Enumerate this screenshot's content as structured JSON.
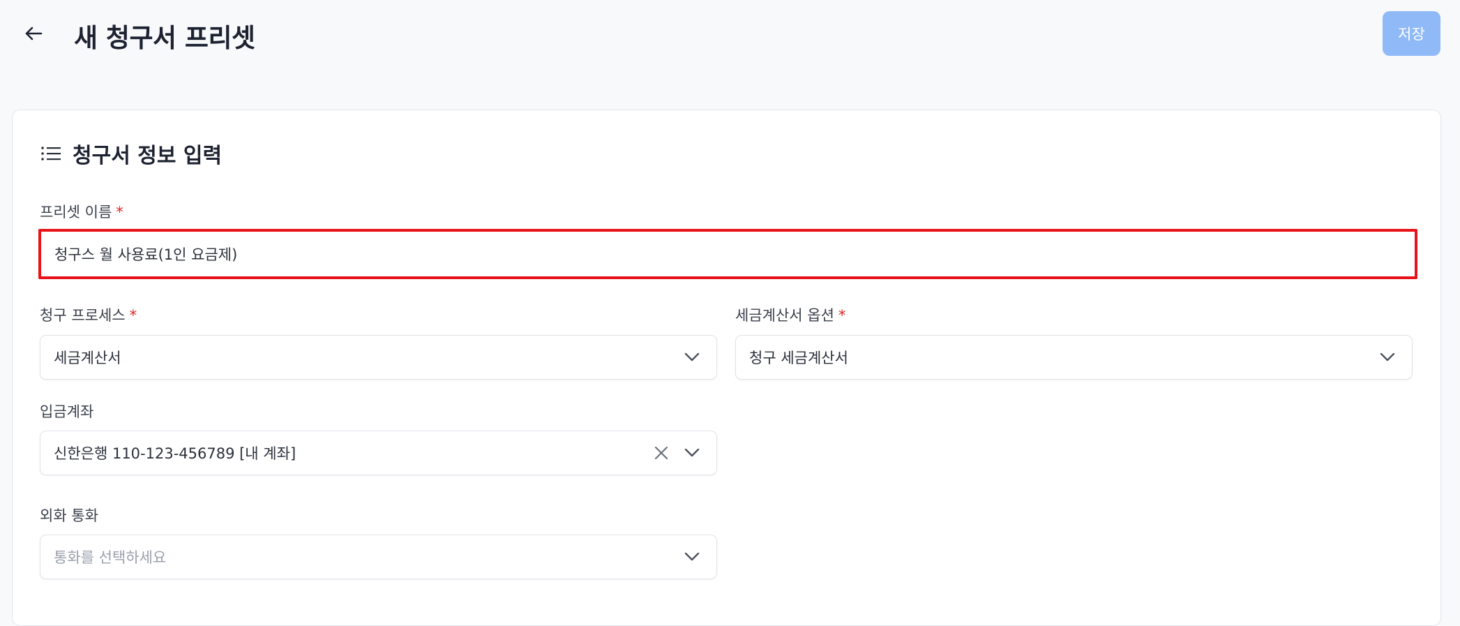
{
  "header": {
    "title": "새 청구서 프리셋",
    "save_label": "저장"
  },
  "section": {
    "title": "청구서 정보 입력"
  },
  "form": {
    "preset_name": {
      "label": "프리셋 이름",
      "required_mark": "*",
      "value": "청구스 월 사용료(1인 요금제)"
    },
    "billing_process": {
      "label": "청구 프로세스",
      "required_mark": "*",
      "value": "세금계산서"
    },
    "tax_invoice_option": {
      "label": "세금계산서 옵션",
      "required_mark": "*",
      "value": "청구 세금계산서"
    },
    "deposit_account": {
      "label": "입금계좌",
      "value": "신한은행 110-123-456789 [내 계좌]"
    },
    "foreign_currency": {
      "label": "외화 통화",
      "placeholder": "통화를 선택하세요"
    }
  },
  "colors": {
    "accent": "#8fb9f7",
    "required": "#e02424",
    "highlight": "#e8121b"
  },
  "icons": {
    "back": "arrow-left-icon",
    "section": "list-icon",
    "dropdown": "chevron-down-icon",
    "clear": "close-icon"
  }
}
